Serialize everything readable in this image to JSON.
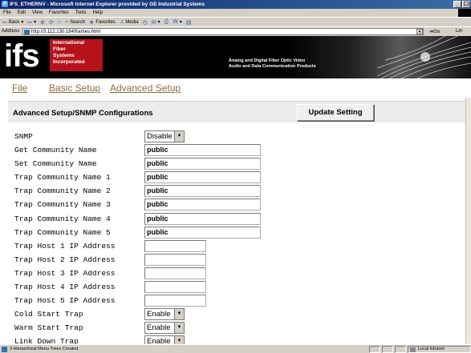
{
  "window": {
    "title": "IFS_ETHERNV - Microsoft Internet Explorer provided by GE Industrial Systems",
    "buttons": [
      "_",
      "☐"
    ]
  },
  "menu": [
    "File",
    "Edit",
    "View",
    "Favorites",
    "Tools",
    "Help"
  ],
  "toolbar": {
    "back": "Back",
    "search": "Search",
    "favorites": "Favorites",
    "media": "Media"
  },
  "address": {
    "label": "Address",
    "url": "http://3.112.130.184/frames.html",
    "go": "Go",
    "links": "Lin"
  },
  "banner": {
    "logo": "ifs",
    "company_lines": [
      "International",
      "Fiber",
      "Systems",
      "Incorporated"
    ],
    "tagline_lines": [
      "Analog and Digital Fiber Optic Video",
      "Audio and Data Communication Products"
    ]
  },
  "nav": {
    "file": "File",
    "basic": "Basic Setup",
    "advanced": "Advanced Setup"
  },
  "section": {
    "title": "Advanced Setup/SNMP Configurations",
    "update_button": "Update Setting"
  },
  "rows": [
    {
      "label": "SNMP",
      "type": "select",
      "value": "Disable"
    },
    {
      "label": "Get Community Name",
      "type": "text",
      "value": "public"
    },
    {
      "label": "Set Community Name",
      "type": "text",
      "value": "public"
    },
    {
      "label": "Trap Community Name 1",
      "type": "text",
      "value": "public"
    },
    {
      "label": "Trap Community Name 2",
      "type": "text",
      "value": "public"
    },
    {
      "label": "Trap Community Name 3",
      "type": "text",
      "value": "public"
    },
    {
      "label": "Trap Community Name 4",
      "type": "text",
      "value": "public"
    },
    {
      "label": "Trap Community Name 5",
      "type": "text",
      "value": "public"
    },
    {
      "label": "Trap Host 1 IP Address",
      "type": "ip",
      "value": ""
    },
    {
      "label": "Trap Host 2 IP Address",
      "type": "ip",
      "value": ""
    },
    {
      "label": "Trap Host 3 IP Address",
      "type": "ip",
      "value": ""
    },
    {
      "label": "Trap Host 4 IP Address",
      "type": "ip",
      "value": ""
    },
    {
      "label": "Trap Host 5 IP Address",
      "type": "ip",
      "value": ""
    },
    {
      "label": "Cold Start Trap",
      "type": "select",
      "value": "Enable"
    },
    {
      "label": "Warm Start Trap",
      "type": "select",
      "value": "Enable"
    },
    {
      "label": "Link Down Trap",
      "type": "select",
      "value": "Enable"
    }
  ],
  "status": {
    "text": "3 Hierarchical Menu Trees Created",
    "zone": "Local intranet"
  },
  "colors": {
    "nav_link": "#8b6f3b",
    "logo_red": "#b5121b",
    "title_bar": "#0a246a"
  }
}
